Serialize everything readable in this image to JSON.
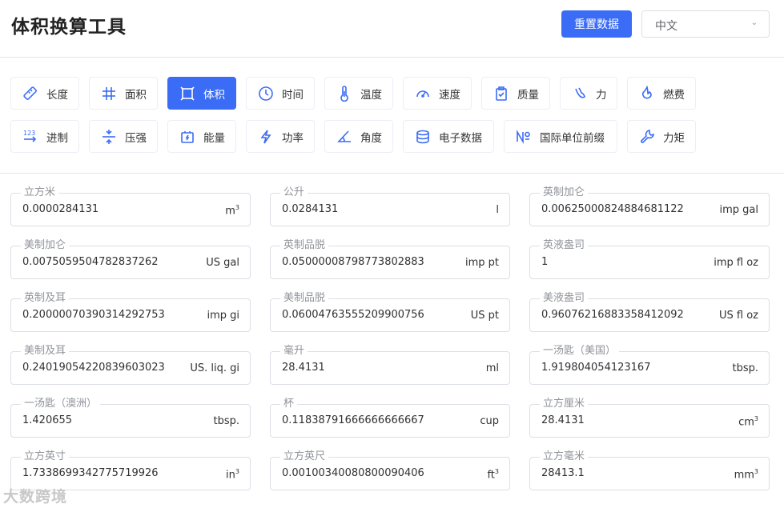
{
  "header": {
    "title": "体积换算工具",
    "reset_label": "重置数据",
    "language": "中文"
  },
  "categories": [
    {
      "label": "长度",
      "icon": "ruler-icon",
      "active": false
    },
    {
      "label": "面积",
      "icon": "hash-icon",
      "active": false
    },
    {
      "label": "体积",
      "icon": "cube-frame-icon",
      "active": true
    },
    {
      "label": "时间",
      "icon": "clock-icon",
      "active": false
    },
    {
      "label": "温度",
      "icon": "thermometer-icon",
      "active": false
    },
    {
      "label": "速度",
      "icon": "speedometer-icon",
      "active": false
    },
    {
      "label": "质量",
      "icon": "clipboard-check-icon",
      "active": false
    },
    {
      "label": "力",
      "icon": "hand-icon",
      "active": false
    },
    {
      "label": "燃费",
      "icon": "flame-icon",
      "active": false
    },
    {
      "label": "进制",
      "icon": "number-base-icon",
      "active": false
    },
    {
      "label": "压强",
      "icon": "compress-icon",
      "active": false
    },
    {
      "label": "能量",
      "icon": "battery-icon",
      "active": false
    },
    {
      "label": "功率",
      "icon": "lightning-icon",
      "active": false
    },
    {
      "label": "角度",
      "icon": "angle-icon",
      "active": false
    },
    {
      "label": "电子数据",
      "icon": "database-icon",
      "active": false
    },
    {
      "label": "国际单位前缀",
      "icon": "numero-icon",
      "active": false
    },
    {
      "label": "力矩",
      "icon": "wrench-icon",
      "active": false
    }
  ],
  "fields": [
    {
      "label": "立方米",
      "value": "0.0000284131",
      "unit": "m",
      "sup": "3"
    },
    {
      "label": "公升",
      "value": "0.0284131",
      "unit": "l",
      "sup": ""
    },
    {
      "label": "英制加仑",
      "value": "0.0062500082488468112​2",
      "unit": "imp gal",
      "sup": ""
    },
    {
      "label": "美制加仑",
      "value": "0.0075059504782837262",
      "unit": "US gal",
      "sup": ""
    },
    {
      "label": "英制品脱",
      "value": "0.0500000879877380288​3",
      "unit": "imp pt",
      "sup": ""
    },
    {
      "label": "英液盎司",
      "value": "1",
      "unit": "imp fl oz",
      "sup": ""
    },
    {
      "label": "英制及耳",
      "value": "0.2000007039031429275​3",
      "unit": "imp gi",
      "sup": ""
    },
    {
      "label": "美制品脱",
      "value": "0.0600476355520990075​6",
      "unit": "US pt",
      "sup": ""
    },
    {
      "label": "美液盎司",
      "value": "0.9607621688335841209​2",
      "unit": "US fl oz",
      "sup": ""
    },
    {
      "label": "美制及耳",
      "value": "0.2401905422083960302​3",
      "unit": "US. liq. gi",
      "sup": ""
    },
    {
      "label": "毫升",
      "value": "28.4131",
      "unit": "ml",
      "sup": ""
    },
    {
      "label": "一汤匙（美国）",
      "value": "1.919804054123167",
      "unit": "tbsp.",
      "sup": ""
    },
    {
      "label": "一汤匙（澳洲）",
      "value": "1.420655",
      "unit": "tbsp.",
      "sup": ""
    },
    {
      "label": "杯",
      "value": "0.1183879166666666666​7",
      "unit": "cup",
      "sup": ""
    },
    {
      "label": "立方厘米",
      "value": "28.4131",
      "unit": "cm",
      "sup": "3"
    },
    {
      "label": "立方英寸",
      "value": "1.7338699342775719926",
      "unit": "in",
      "sup": "3"
    },
    {
      "label": "立方英尺",
      "value": "0.0010034008080009040​6",
      "unit": "ft",
      "sup": "3"
    },
    {
      "label": "立方毫米",
      "value": "28413.1",
      "unit": "mm",
      "sup": "3"
    }
  ],
  "watermark": "大数跨境"
}
